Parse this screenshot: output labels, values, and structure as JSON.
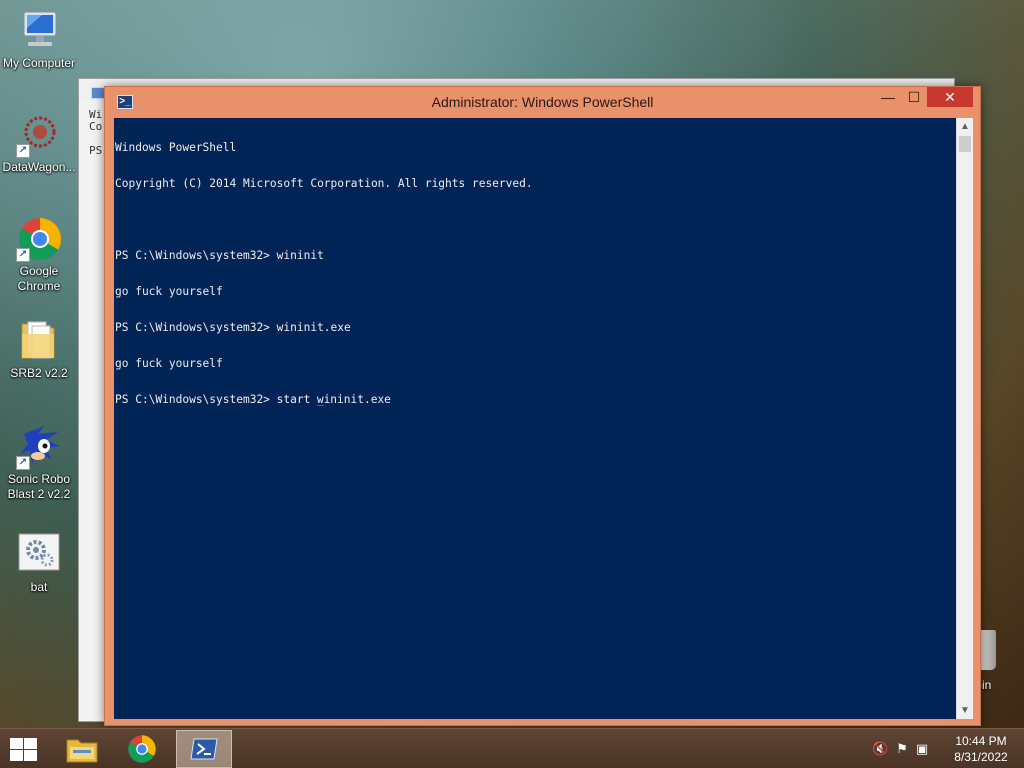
{
  "desktop": {
    "icons": [
      {
        "label": "My Computer"
      },
      {
        "label": "DataWagon..."
      },
      {
        "label": "Google Chrome"
      },
      {
        "label": "SRB2 v2.2"
      },
      {
        "label": "Sonic Robo Blast 2 v2.2"
      },
      {
        "label": "bat"
      }
    ],
    "recycle_bin_label": "e Bin"
  },
  "back_window": {
    "text_lines": [
      "Wi",
      "Co",
      "",
      "PS"
    ]
  },
  "window": {
    "title": "Administrator: Windows PowerShell",
    "min_glyph": "—",
    "max_glyph": "☐",
    "close_glyph": "✕",
    "colors": {
      "frame": "#e8916a",
      "console_bg": "#012456",
      "close": "#c7392f"
    }
  },
  "console": {
    "lines": [
      "Windows PowerShell",
      "Copyright (C) 2014 Microsoft Corporation. All rights reserved.",
      "",
      "PS C:\\Windows\\system32> wininit",
      "go fuck yourself",
      "PS C:\\Windows\\system32> wininit.exe",
      "go fuck yourself"
    ],
    "current_prompt": "PS C:\\Windows\\system32> ",
    "current_input_before_cursor": "start ",
    "current_input_after_cursor": "wininit.exe"
  },
  "taskbar": {
    "apps": [
      {
        "name": "file-explorer"
      },
      {
        "name": "google-chrome"
      },
      {
        "name": "windows-powershell",
        "active": true
      }
    ],
    "tray": {
      "icons": [
        "volume-muted-icon",
        "action-center-flag-icon",
        "network-icon"
      ]
    },
    "clock": {
      "time": "10:44 PM",
      "date": "8/31/2022"
    }
  }
}
